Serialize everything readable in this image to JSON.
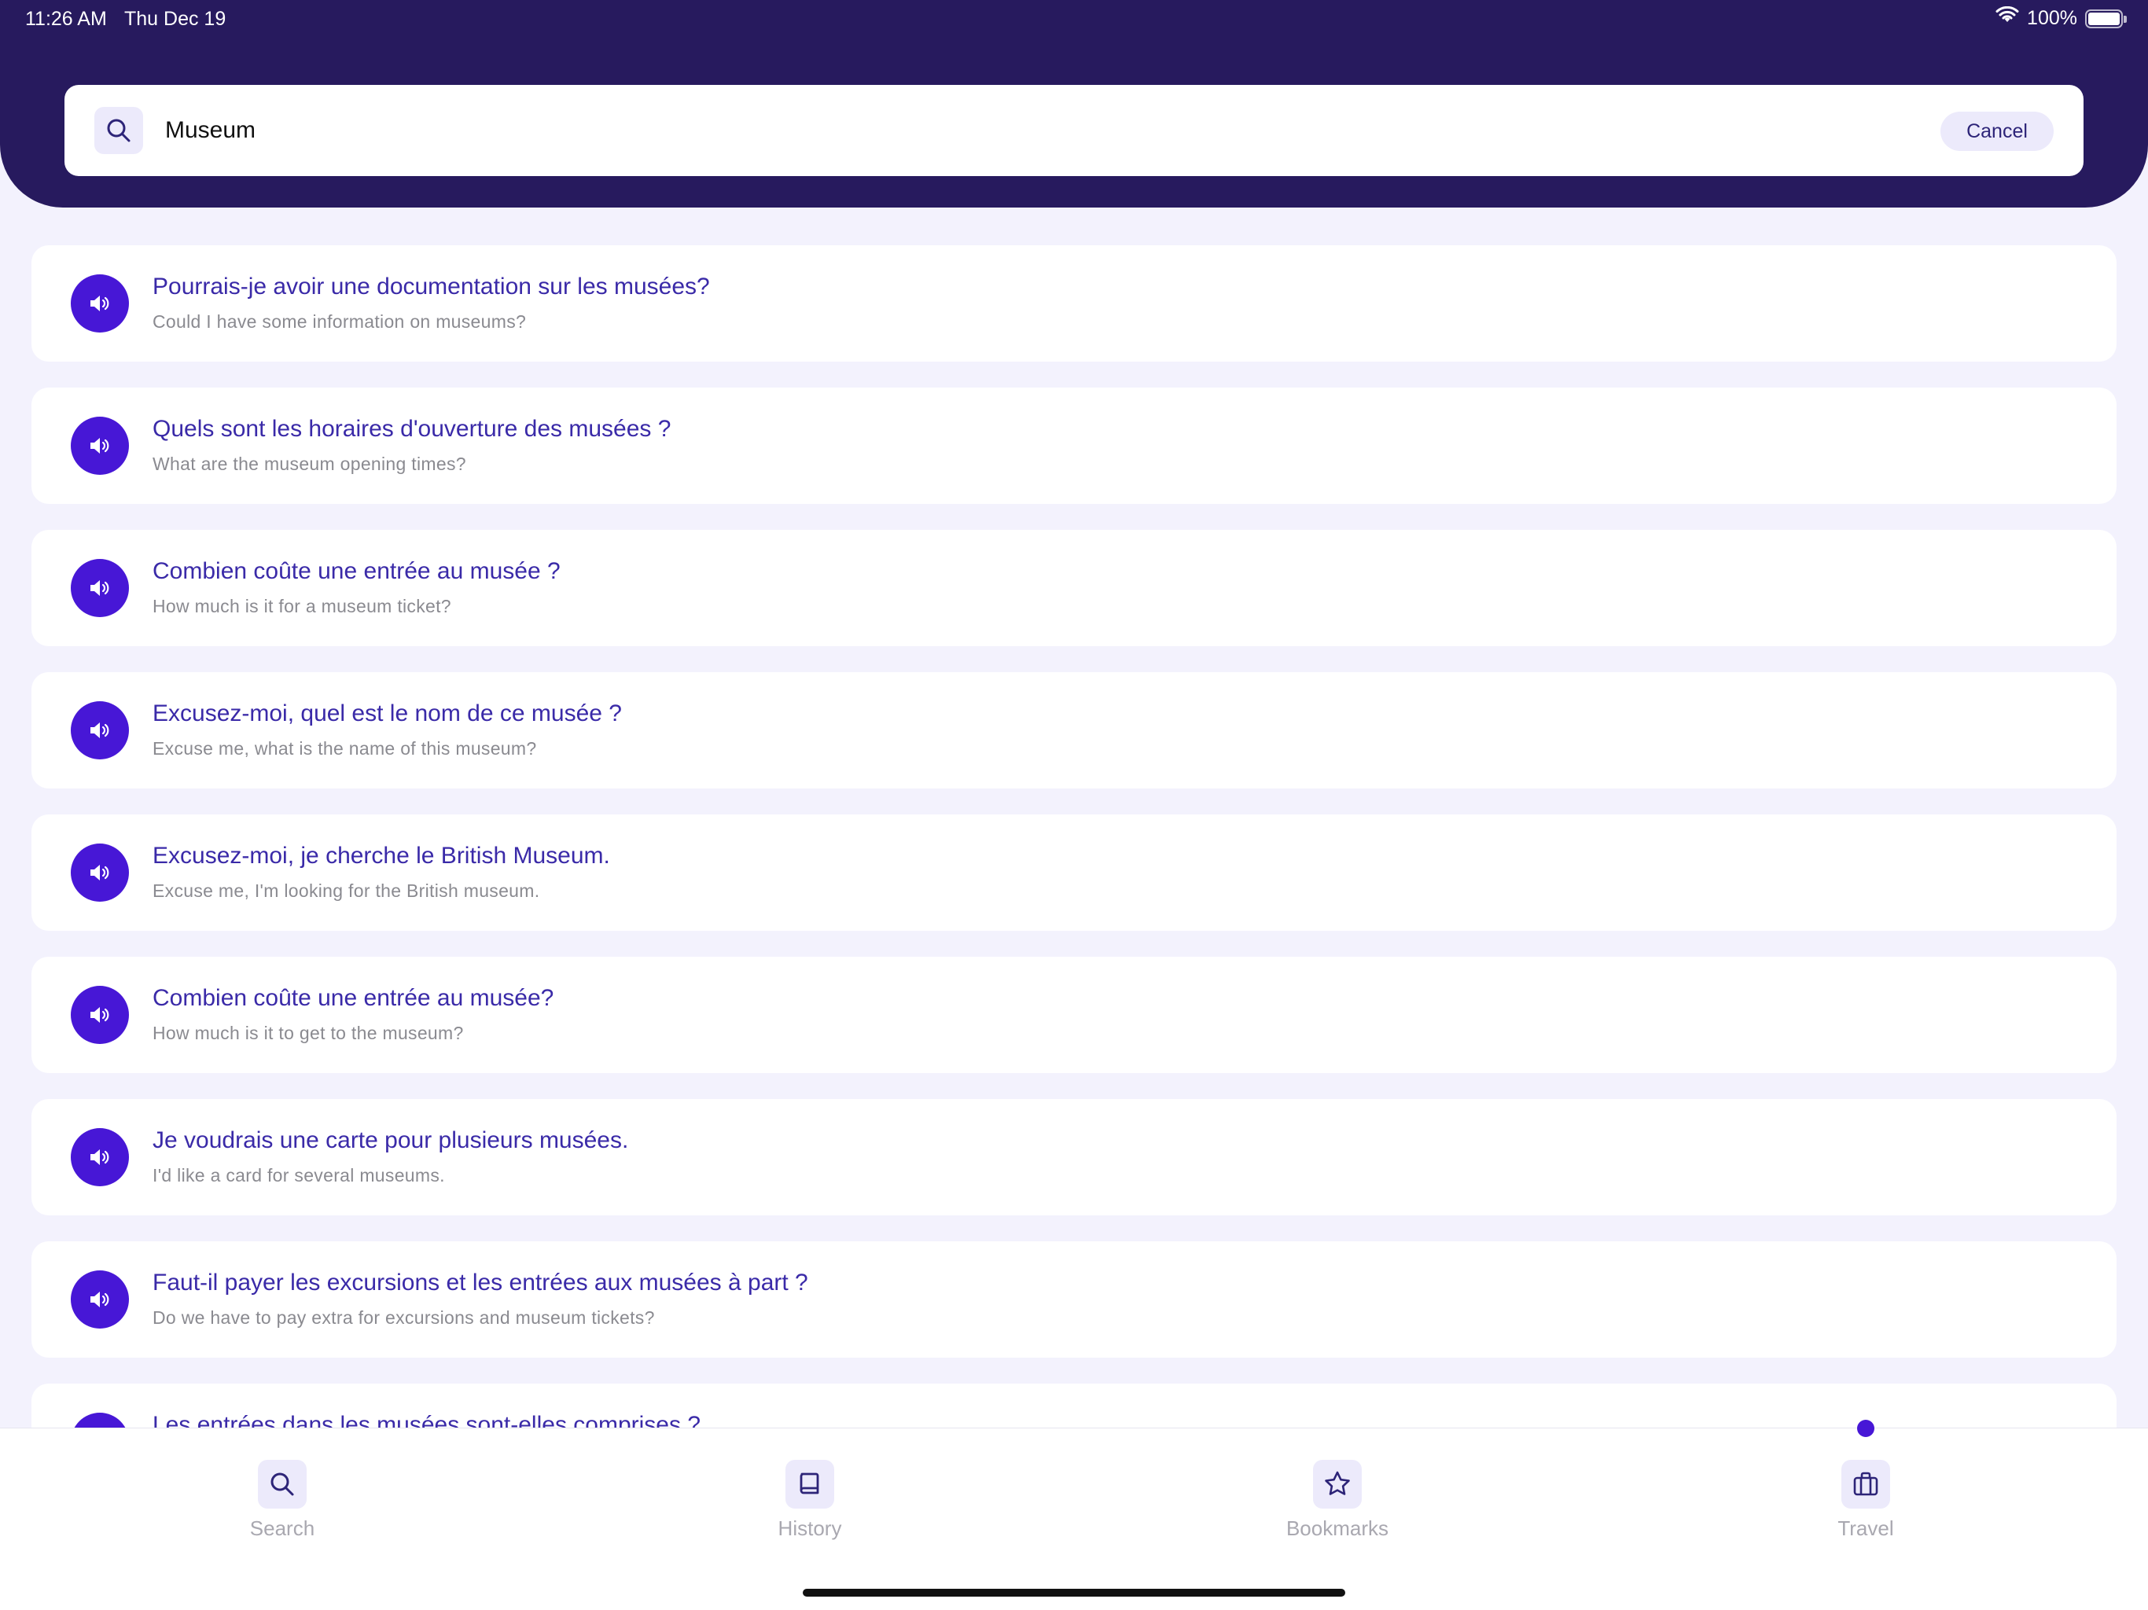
{
  "status_bar": {
    "time": "11:26 AM",
    "date": "Thu Dec 19",
    "battery": "100%",
    "icons": [
      "wifi-icon",
      "battery-icon"
    ]
  },
  "search": {
    "value": "Museum",
    "cancel_label": "Cancel",
    "icon": "search-icon"
  },
  "results": [
    {
      "fr": "Pourrais-je avoir une documentation sur les musées?",
      "en": "Could I have some information on museums?"
    },
    {
      "fr": "Quels sont les horaires d'ouverture des musées ?",
      "en": "What are the museum opening times?"
    },
    {
      "fr": "Combien coûte une entrée au musée ?",
      "en": "How much is it for a museum ticket?"
    },
    {
      "fr": "Excusez-moi, quel est le nom de ce musée ?",
      "en": "Excuse me, what is the name of this museum?"
    },
    {
      "fr": "Excusez-moi, je cherche le British Museum.",
      "en": "Excuse me, I'm looking for the British museum."
    },
    {
      "fr": "Combien coûte une entrée au musée?",
      "en": "How much is it to get to the museum?"
    },
    {
      "fr": "Je voudrais une carte pour plusieurs musées.",
      "en": "I'd like a card for several museums."
    },
    {
      "fr": "Faut-il payer les excursions et les entrées aux musées à part ?",
      "en": "Do we have to pay extra for excursions and museum tickets?"
    },
    {
      "fr": "Les entrées dans les musées sont-elles comprises ?",
      "en": ""
    }
  ],
  "tabs": [
    {
      "label": "Search",
      "icon": "search-icon"
    },
    {
      "label": "History",
      "icon": "book-icon"
    },
    {
      "label": "Bookmarks",
      "icon": "star-icon"
    },
    {
      "label": "Travel",
      "icon": "briefcase-icon",
      "active": true
    }
  ],
  "colors": {
    "header_bg": "#271a5e",
    "accent": "#4717d6",
    "phrase_text": "#3a2aa8",
    "page_bg": "#f3f2fd"
  }
}
